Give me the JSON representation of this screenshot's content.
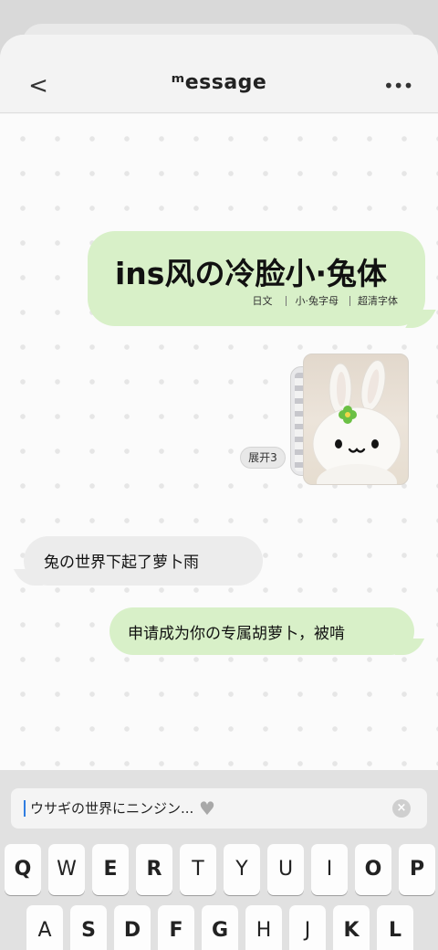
{
  "header": {
    "back_label": "<",
    "title": "ᵐessage",
    "more_label": "•••"
  },
  "messages": {
    "big_title": "ins风の冷脸小·兔体",
    "tags": [
      "日文",
      "小·兔字母",
      "超清字体"
    ],
    "expand_label": "展开3",
    "left_text": "兔の世界下起了萝卜雨",
    "right_text": "申请成为你の专属胡萝卜，被啃"
  },
  "input": {
    "value": "ウサギの世界にニンジン...",
    "heart_icon": "gray-heart-icon",
    "clear_label": "×"
  },
  "keyboard": {
    "row1": [
      "Q",
      "W",
      "E",
      "R",
      "T",
      "Y",
      "U",
      "I",
      "O",
      "P"
    ],
    "row2": [
      "A",
      "S",
      "D",
      "F",
      "G",
      "H",
      "J",
      "K",
      "L"
    ]
  },
  "colors": {
    "bubble_green": "#d8f0c8",
    "bubble_gray": "#ececec",
    "caret_blue": "#2f7de1"
  }
}
